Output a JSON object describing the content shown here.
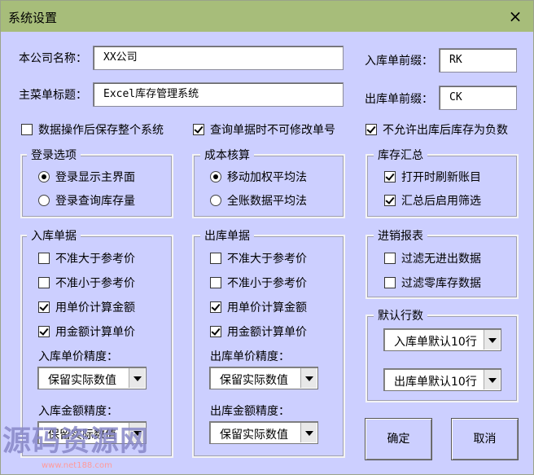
{
  "window": {
    "title": "系统设置",
    "close_icon": "×"
  },
  "company": {
    "label": "本公司名称：",
    "value": "XX公司"
  },
  "menu_title": {
    "label": "主菜单标题：",
    "value": "Excel库存管理系统"
  },
  "in_prefix": {
    "label": "入库单前缀：",
    "value": "RK"
  },
  "out_prefix": {
    "label": "出库单前缀：",
    "value": "CK"
  },
  "options": {
    "save_all": {
      "label": "数据操作后保存整个系统",
      "checked": false
    },
    "no_edit_no": {
      "label": "查询单据时不可修改单号",
      "checked": true
    },
    "no_negative": {
      "label": "不允许出库后库存为负数",
      "checked": true
    }
  },
  "login": {
    "title": "登录选项",
    "opt1": "登录显示主界面",
    "opt2": "登录查询库存量",
    "selected": 1
  },
  "cost": {
    "title": "成本核算",
    "opt1": "移动加权平均法",
    "opt2": "全账数据平均法",
    "selected": 1
  },
  "stock": {
    "title": "库存汇总",
    "opt1": "打开时刷新账目",
    "opt2": "汇总后启用筛选"
  },
  "inbound": {
    "title": "入库单据",
    "c1": "不准大于参考价",
    "c2": "不准小于参考价",
    "c3": "用单价计算金额",
    "c4": "用金额计算单价",
    "price_label": "入库单价精度：",
    "price_value": "保留实际数值",
    "amount_label": "入库金额精度：",
    "amount_value": "保留实际数值"
  },
  "outbound": {
    "title": "出库单据",
    "c1": "不准大于参考价",
    "c2": "不准小于参考价",
    "c3": "用单价计算金额",
    "c4": "用金额计算单价",
    "price_label": "出库单价精度：",
    "price_value": "保留实际数值",
    "amount_label": "出库金额精度：",
    "amount_value": "保留实际数值"
  },
  "report": {
    "title": "进销报表",
    "opt1": "过滤无进出数据",
    "opt2": "过滤零库存数据"
  },
  "rows": {
    "title": "默认行数",
    "in_value": "入库单默认10行",
    "out_value": "出库单默认10行"
  },
  "buttons": {
    "ok": "确定",
    "cancel": "取消"
  },
  "watermark": {
    "text": "源码资源网",
    "url": "www.net188.com"
  }
}
